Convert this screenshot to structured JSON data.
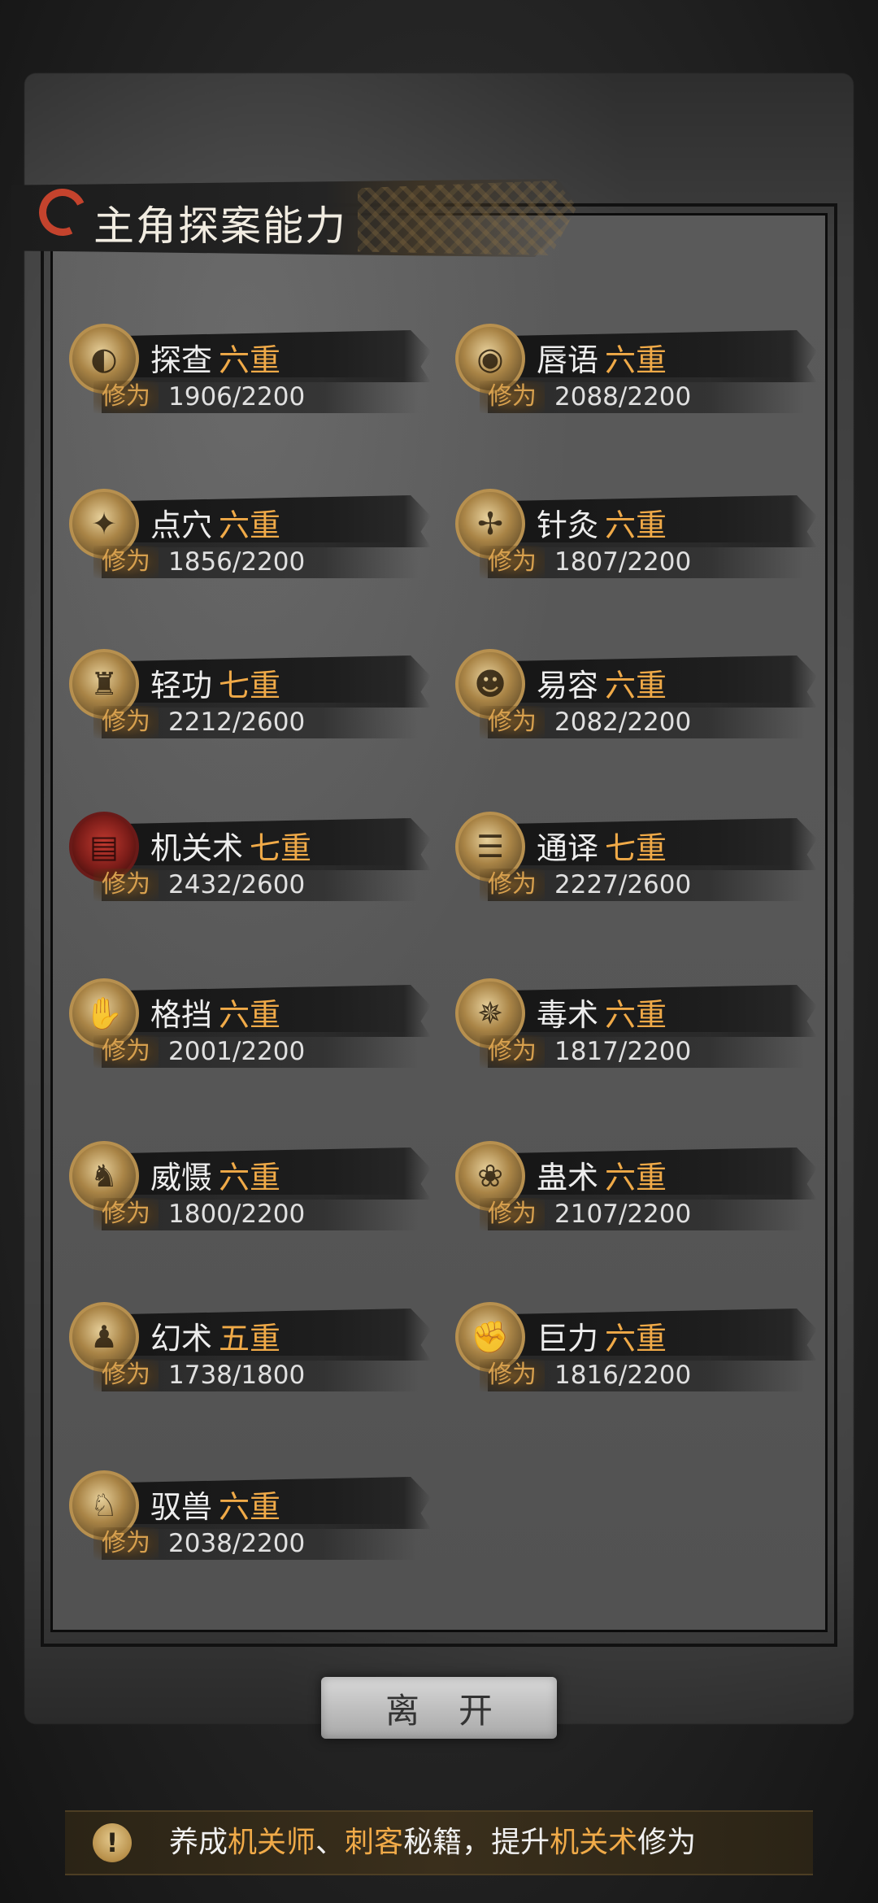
{
  "header": {
    "title": "主角探案能力"
  },
  "skills": [
    {
      "name": "探查",
      "level": "六重",
      "xp_label": "修为",
      "xp": "1906/2200",
      "icon": "lantern-icon"
    },
    {
      "name": "唇语",
      "level": "六重",
      "xp_label": "修为",
      "xp": "2088/2200",
      "icon": "mask-icon"
    },
    {
      "name": "点穴",
      "level": "六重",
      "xp_label": "修为",
      "xp": "1856/2200",
      "icon": "fist-strike-icon"
    },
    {
      "name": "针灸",
      "level": "六重",
      "xp_label": "修为",
      "xp": "1807/2200",
      "icon": "needle-icon"
    },
    {
      "name": "轻功",
      "level": "七重",
      "xp_label": "修为",
      "xp": "2212/2600",
      "icon": "boots-icon"
    },
    {
      "name": "易容",
      "level": "六重",
      "xp_label": "修为",
      "xp": "2082/2200",
      "icon": "disguise-mask-icon"
    },
    {
      "name": "机关术",
      "level": "七重",
      "xp_label": "修为",
      "xp": "2432/2600",
      "icon": "mechanism-icon"
    },
    {
      "name": "通译",
      "level": "七重",
      "xp_label": "修为",
      "xp": "2227/2600",
      "icon": "scroll-icon"
    },
    {
      "name": "格挡",
      "level": "六重",
      "xp_label": "修为",
      "xp": "2001/2200",
      "icon": "shield-arm-icon"
    },
    {
      "name": "毒术",
      "level": "六重",
      "xp_label": "修为",
      "xp": "1817/2200",
      "icon": "spider-icon"
    },
    {
      "name": "威慑",
      "level": "六重",
      "xp_label": "修为",
      "xp": "1800/2200",
      "icon": "warrior-icon"
    },
    {
      "name": "蛊术",
      "level": "六重",
      "xp_label": "修为",
      "xp": "2107/2200",
      "icon": "worm-icon"
    },
    {
      "name": "幻术",
      "level": "五重",
      "xp_label": "修为",
      "xp": "1738/1800",
      "icon": "hooded-figure-icon"
    },
    {
      "name": "巨力",
      "level": "六重",
      "xp_label": "修为",
      "xp": "1816/2200",
      "icon": "raised-fist-icon"
    },
    {
      "name": "驭兽",
      "level": "六重",
      "xp_label": "修为",
      "xp": "2038/2200",
      "icon": "wolf-icon"
    }
  ],
  "leave_button": {
    "label": "离开"
  },
  "tip": {
    "part1": "养成",
    "hl1": "机关师",
    "sep": "、",
    "hl2": "刺客",
    "part2": "秘籍，提升",
    "hl3": "机关术",
    "part3": "修为"
  },
  "colors": {
    "level_accent": "#f0aa48",
    "emblem_red": "#c4432d"
  }
}
